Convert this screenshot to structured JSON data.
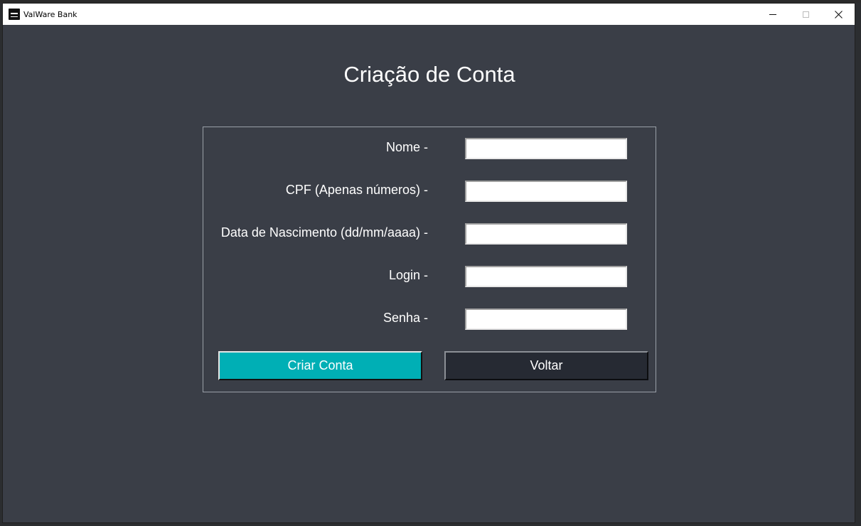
{
  "window": {
    "title": "ValWare Bank"
  },
  "page": {
    "title": "Criação de Conta"
  },
  "form": {
    "fields": [
      {
        "label": "Nome -",
        "value": ""
      },
      {
        "label": "CPF (Apenas números) -",
        "value": ""
      },
      {
        "label": "Data de Nascimento (dd/mm/aaaa) -",
        "value": ""
      },
      {
        "label": "Login -",
        "value": ""
      },
      {
        "label": "Senha -",
        "value": ""
      }
    ],
    "create_label": "Criar Conta",
    "back_label": "Voltar"
  },
  "colors": {
    "background": "#3a3e47",
    "primary_button": "#00afb5",
    "secondary_button": "#262a33"
  },
  "icons": {
    "app": "bank-app-icon",
    "minimize": "minimize-icon",
    "maximize": "maximize-icon",
    "close": "close-icon"
  }
}
